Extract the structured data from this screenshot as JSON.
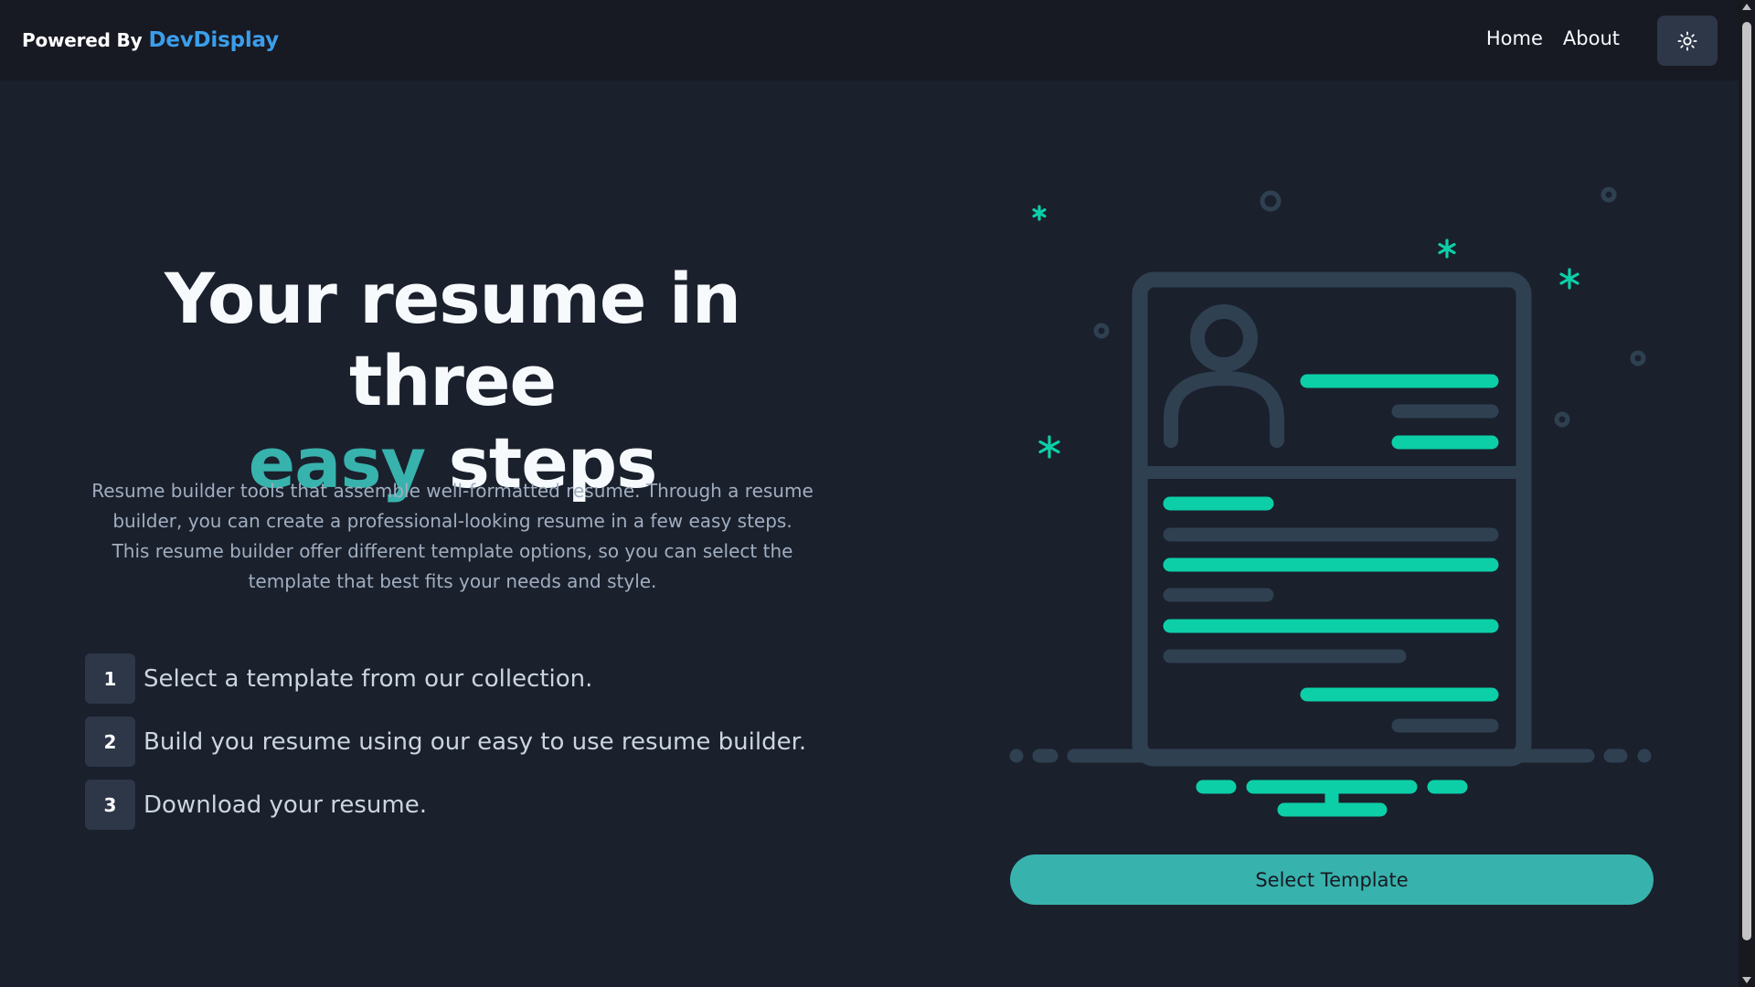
{
  "header": {
    "powered_by": "Powered By",
    "brand_name": "DevDisplay",
    "nav": [
      {
        "label": "Home"
      },
      {
        "label": "About"
      }
    ],
    "theme_toggle_icon": "sun-icon"
  },
  "hero": {
    "title_line1": "Your resume in three",
    "title_accent": "easy",
    "title_rest": "steps",
    "description": "Resume builder tools that assemble well-formatted resume. Through a resume builder, you can create a professional-looking resume in a few easy steps. This resume builder offer different template options, so you can select the template that best fits your needs and style."
  },
  "steps": [
    {
      "number": "1",
      "text": "Select a template from our collection."
    },
    {
      "number": "2",
      "text": "Build you resume using our easy to use resume builder."
    },
    {
      "number": "3",
      "text": "Download your resume."
    }
  ],
  "cta": {
    "label": "Select Template"
  },
  "colors": {
    "background": "#1a202c",
    "navbar": "#171923",
    "accent": "#38b2ac",
    "illustration_teal": "#0ccfa8",
    "illustration_slate": "#2f4051",
    "brand_blue": "#3b9eea"
  }
}
